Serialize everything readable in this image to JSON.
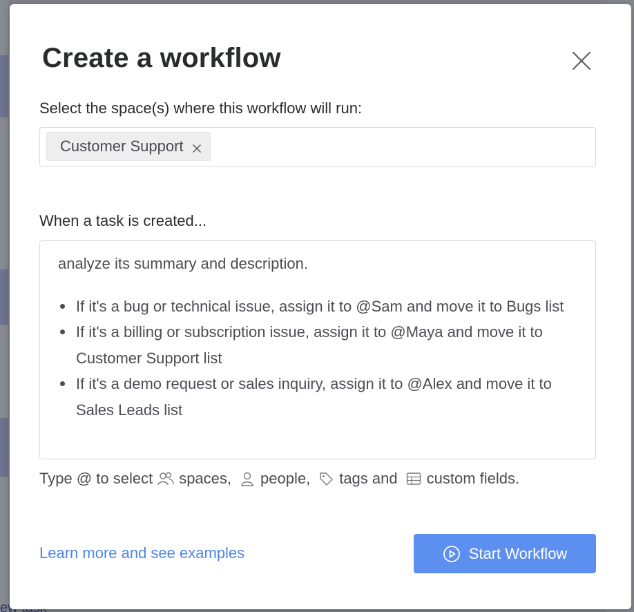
{
  "modal": {
    "title": "Create a workflow",
    "space_label": "Select the space(s) where this workflow will run:",
    "selected_spaces": [
      "Customer Support"
    ],
    "trigger_label": "When a task is created...",
    "prompt": {
      "intro": "analyze its summary and description.",
      "items": [
        "If it's a bug or technical issue, assign it to @Sam and move it to Bugs list",
        "If it's a billing or subscription issue, assign it to @Maya and move it to Customer Support list",
        "If it's a demo request or sales inquiry, assign it to @Alex and move it to Sales Leads list"
      ]
    },
    "hint": {
      "prefix": "Type @ to select",
      "spaces": "spaces,",
      "people": "people,",
      "tags": "tags and",
      "fields": "custom fields."
    },
    "learn_link": "Learn more and see examples",
    "start_button": "Start Workflow"
  },
  "background": {
    "bottom_link": "ew task"
  },
  "colors": {
    "primary": "#5d8ff0",
    "link": "#4d85e8",
    "text": "#2b2c30"
  }
}
